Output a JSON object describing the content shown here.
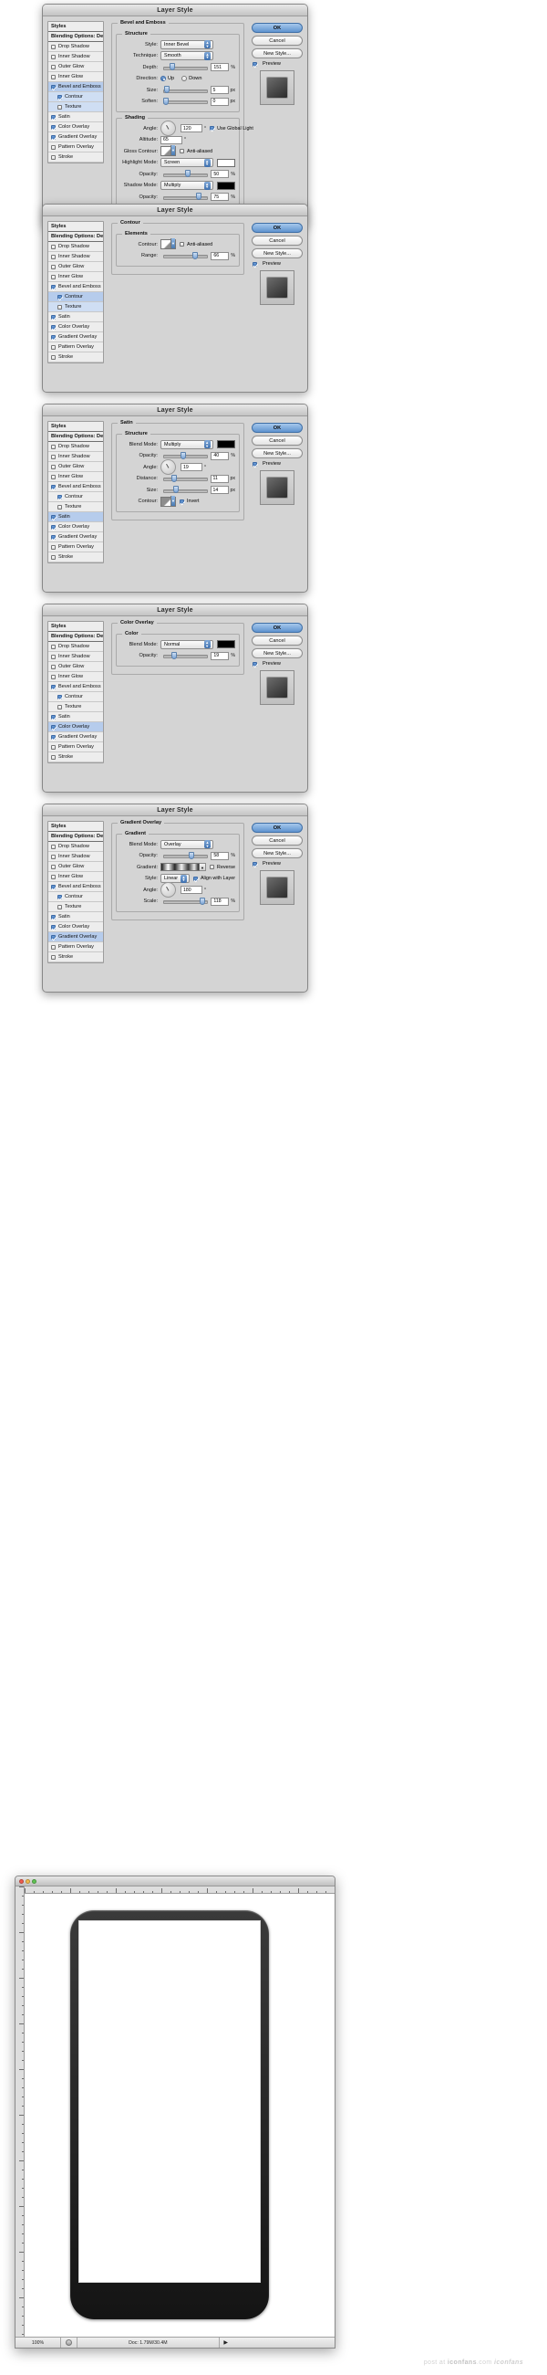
{
  "dialog_title": "Layer Style",
  "buttons": {
    "ok": "OK",
    "cancel": "Cancel",
    "new_style": "New Style...",
    "preview": "Preview"
  },
  "styles_list": {
    "header": "Styles",
    "blending": "Blending Options: Default",
    "items": [
      "Drop Shadow",
      "Inner Shadow",
      "Outer Glow",
      "Inner Glow",
      "Bevel and Emboss",
      "Contour",
      "Texture",
      "Satin",
      "Color Overlay",
      "Gradient Overlay",
      "Pattern Overlay",
      "Stroke"
    ]
  },
  "dialogs": [
    {
      "id": "bevel-and-emboss",
      "panel_title": "Bevel and Emboss",
      "selected": "Bevel and Emboss",
      "groups": [
        {
          "label": "Structure",
          "fields": [
            {
              "label": "Style:",
              "type": "select",
              "value": "Inner Bevel"
            },
            {
              "label": "Technique:",
              "type": "select",
              "value": "Smooth"
            },
            {
              "label": "Depth:",
              "type": "slider_num",
              "value": "151",
              "unit": "%",
              "pos": 14
            },
            {
              "label": "Direction:",
              "type": "radio",
              "options": [
                "Up",
                "Down"
              ],
              "value": "Up"
            },
            {
              "label": "Size:",
              "type": "slider_num",
              "value": "5",
              "unit": "px",
              "pos": 3
            },
            {
              "label": "Soften:",
              "type": "slider_num",
              "value": "0",
              "unit": "px",
              "pos": 1
            }
          ]
        },
        {
          "label": "Shading",
          "fields": [
            {
              "label": "Angle:",
              "type": "dial",
              "value": "120",
              "unit": "°",
              "check": "Use Global Light"
            },
            {
              "label": "Altitude:",
              "type": "num",
              "value": "65",
              "unit": "°"
            },
            {
              "label": "Gloss Contour:",
              "type": "contour",
              "check": "Anti-aliased"
            },
            {
              "label": "Highlight Mode:",
              "type": "select_swatch",
              "value": "Screen",
              "swatch": "#ffffff"
            },
            {
              "label": "Opacity:",
              "type": "slider_num",
              "value": "50",
              "unit": "%",
              "pos": 48
            },
            {
              "label": "Shadow Mode:",
              "type": "select_swatch",
              "value": "Multiply",
              "swatch": "#000000"
            },
            {
              "label": "Opacity:",
              "type": "slider_num",
              "value": "75",
              "unit": "%",
              "pos": 72
            }
          ]
        }
      ]
    },
    {
      "id": "contour",
      "panel_title": "Contour",
      "selected": "Contour",
      "groups": [
        {
          "label": "Elements",
          "fields": [
            {
              "label": "Contour:",
              "type": "contour",
              "check": "Anti-aliased"
            },
            {
              "label": "Range:",
              "type": "slider_num",
              "value": "66",
              "unit": "%",
              "pos": 64
            }
          ]
        }
      ]
    },
    {
      "id": "satin",
      "panel_title": "Satin",
      "selected": "Satin",
      "groups": [
        {
          "label": "Structure",
          "fields": [
            {
              "label": "Blend Mode:",
              "type": "select_swatch",
              "value": "Multiply",
              "swatch": "#000000"
            },
            {
              "label": "Opacity:",
              "type": "slider_num",
              "value": "40",
              "unit": "%",
              "pos": 38
            },
            {
              "label": "Angle:",
              "type": "dial",
              "value": "19",
              "unit": "°"
            },
            {
              "label": "Distance:",
              "type": "slider_num",
              "value": "11",
              "unit": "px",
              "pos": 18
            },
            {
              "label": "Size:",
              "type": "slider_num",
              "value": "14",
              "unit": "px",
              "pos": 22
            },
            {
              "label": "Contour:",
              "type": "contour_invert",
              "check": "Invert"
            }
          ]
        }
      ]
    },
    {
      "id": "color-overlay",
      "panel_title": "Color Overlay",
      "selected": "Color Overlay",
      "groups": [
        {
          "label": "Color",
          "fields": [
            {
              "label": "Blend Mode:",
              "type": "select_swatch",
              "value": "Normal",
              "swatch": "#000000"
            },
            {
              "label": "Opacity:",
              "type": "slider_num",
              "value": "19",
              "unit": "%",
              "pos": 18
            }
          ]
        }
      ]
    },
    {
      "id": "gradient-overlay",
      "panel_title": "Gradient Overlay",
      "selected": "Gradient Overlay",
      "groups": [
        {
          "label": "Gradient",
          "fields": [
            {
              "label": "Blend Mode:",
              "type": "select",
              "value": "Overlay"
            },
            {
              "label": "Opacity:",
              "type": "slider_num",
              "value": "58",
              "unit": "%",
              "pos": 56
            },
            {
              "label": "Gradient:",
              "type": "gradient",
              "check": "Reverse"
            },
            {
              "label": "Style:",
              "type": "select",
              "value": "Linear",
              "check": "Align with Layer"
            },
            {
              "label": "Angle:",
              "type": "dial",
              "value": "180",
              "unit": "°"
            },
            {
              "label": "Scale:",
              "type": "slider_num",
              "value": "118",
              "unit": "%",
              "pos": 80
            }
          ]
        }
      ]
    }
  ],
  "photoshop": {
    "zoom": "100%",
    "doc": "Doc: 1.79M/30.4M"
  },
  "watermark": {
    "pre": "post at ",
    "site": "iconfans",
    "suffix": ".com ",
    "logo": "iconfans"
  },
  "accent": "#b6ccec"
}
